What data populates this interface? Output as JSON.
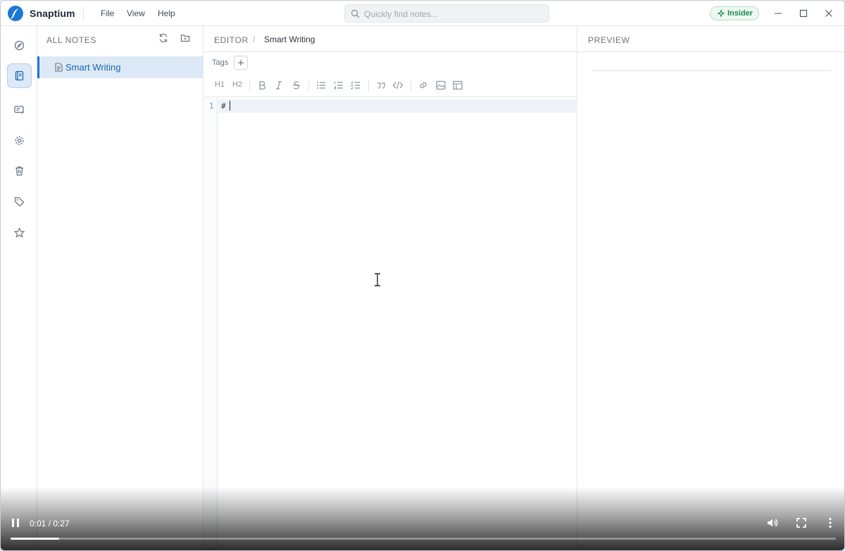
{
  "app": {
    "name": "Snaptium",
    "menu": [
      "File",
      "View",
      "Help"
    ],
    "search_placeholder": "Quickly find notes...",
    "badge": "Insider"
  },
  "rail": {
    "items": [
      {
        "icon": "compass-icon"
      },
      {
        "icon": "notebook-icon",
        "active": true
      },
      {
        "icon": "ai-card-icon"
      },
      {
        "icon": "settings-icon"
      },
      {
        "icon": "trash-icon"
      },
      {
        "icon": "tag-icon"
      },
      {
        "icon": "star-icon"
      }
    ]
  },
  "notes_panel": {
    "title": "ALL NOTES",
    "items": [
      {
        "title": "Smart Writing",
        "selected": true
      }
    ]
  },
  "editor": {
    "breadcrumb_root": "EDITOR",
    "breadcrumb_sep": "/",
    "breadcrumb_current": "Smart Writing",
    "tags_label": "Tags",
    "toolbar": {
      "h1": "H1",
      "h2": "H2"
    },
    "line_number": "1",
    "content": "#"
  },
  "preview": {
    "title": "PREVIEW"
  },
  "video": {
    "time": "0:01 / 0:27",
    "progress": 0.059
  },
  "colors": {
    "accent": "#1b77d6",
    "selected_bg": "#dde9f6",
    "badge_green": "#1f8a52"
  }
}
